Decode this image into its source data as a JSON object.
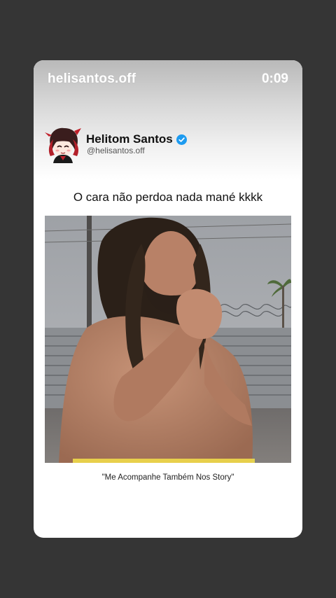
{
  "story": {
    "username": "helisantos.off",
    "time": "0:09"
  },
  "post": {
    "display_name": "Helitom Santos",
    "handle": "@helisantos.off",
    "verified_icon": "verified-badge-icon",
    "caption": "O cara não perdoa nada mané kkkk",
    "footer": "\"Me Acompanhe Também Nos Story\""
  },
  "colors": {
    "background": "#353535",
    "card": "#ffffff",
    "verified": "#1d9bf0"
  }
}
